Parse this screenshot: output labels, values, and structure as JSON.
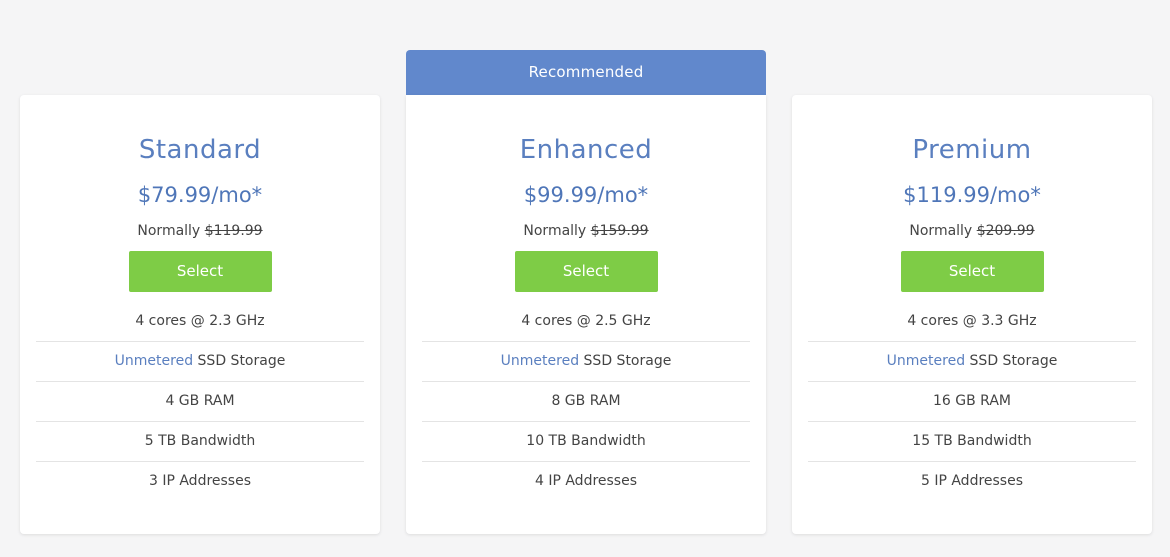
{
  "banner": {
    "label": "Recommended"
  },
  "highlight_color": "#5a7fbf",
  "button_color": "#7ecc46",
  "plans": [
    {
      "name": "Standard",
      "price": "$79.99/mo*",
      "normally_label": "Normally",
      "normal_price": "$119.99",
      "select_label": "Select",
      "features": {
        "cpu": "4 cores @ 2.3 GHz",
        "storage_highlight": "Unmetered",
        "storage_rest": "SSD Storage",
        "ram": "4 GB RAM",
        "bandwidth": "5 TB Bandwidth",
        "ips": "3 IP Addresses"
      }
    },
    {
      "name": "Enhanced",
      "price": "$99.99/mo*",
      "normally_label": "Normally",
      "normal_price": "$159.99",
      "select_label": "Select",
      "features": {
        "cpu": "4 cores @ 2.5 GHz",
        "storage_highlight": "Unmetered",
        "storage_rest": "SSD Storage",
        "ram": "8 GB RAM",
        "bandwidth": "10 TB Bandwidth",
        "ips": "4 IP Addresses"
      }
    },
    {
      "name": "Premium",
      "price": "$119.99/mo*",
      "normally_label": "Normally",
      "normal_price": "$209.99",
      "select_label": "Select",
      "features": {
        "cpu": "4 cores @ 3.3 GHz",
        "storage_highlight": "Unmetered",
        "storage_rest": "SSD Storage",
        "ram": "16 GB RAM",
        "bandwidth": "15 TB Bandwidth",
        "ips": "5 IP Addresses"
      }
    }
  ]
}
